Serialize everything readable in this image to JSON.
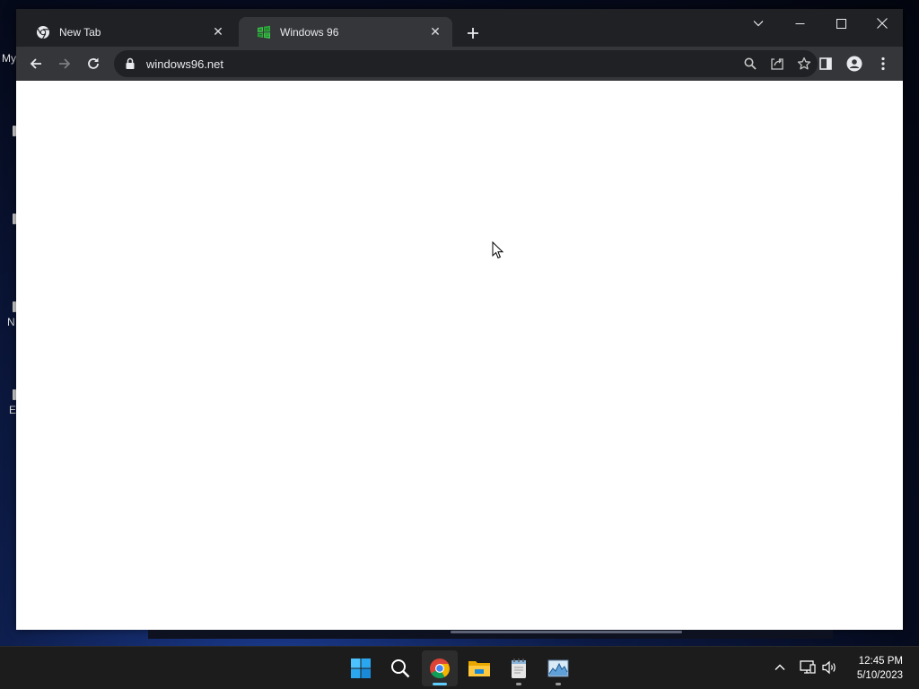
{
  "desktop": {
    "peek_labels": [
      "My",
      "N",
      "E"
    ]
  },
  "browser": {
    "tabs": [
      {
        "title": "New Tab",
        "favicon": "chrome-icon",
        "active": false
      },
      {
        "title": "Windows 96",
        "favicon": "windows96-icon",
        "active": true
      }
    ],
    "address": "windows96.net",
    "accent_color": "#35363a"
  },
  "taskbar": {
    "apps": [
      "start-icon",
      "search-icon",
      "chrome-icon",
      "file-explorer-icon",
      "notepad-icon",
      "task-manager-icon"
    ],
    "clock": {
      "time": "12:45 PM",
      "date": "5/10/2023"
    }
  }
}
